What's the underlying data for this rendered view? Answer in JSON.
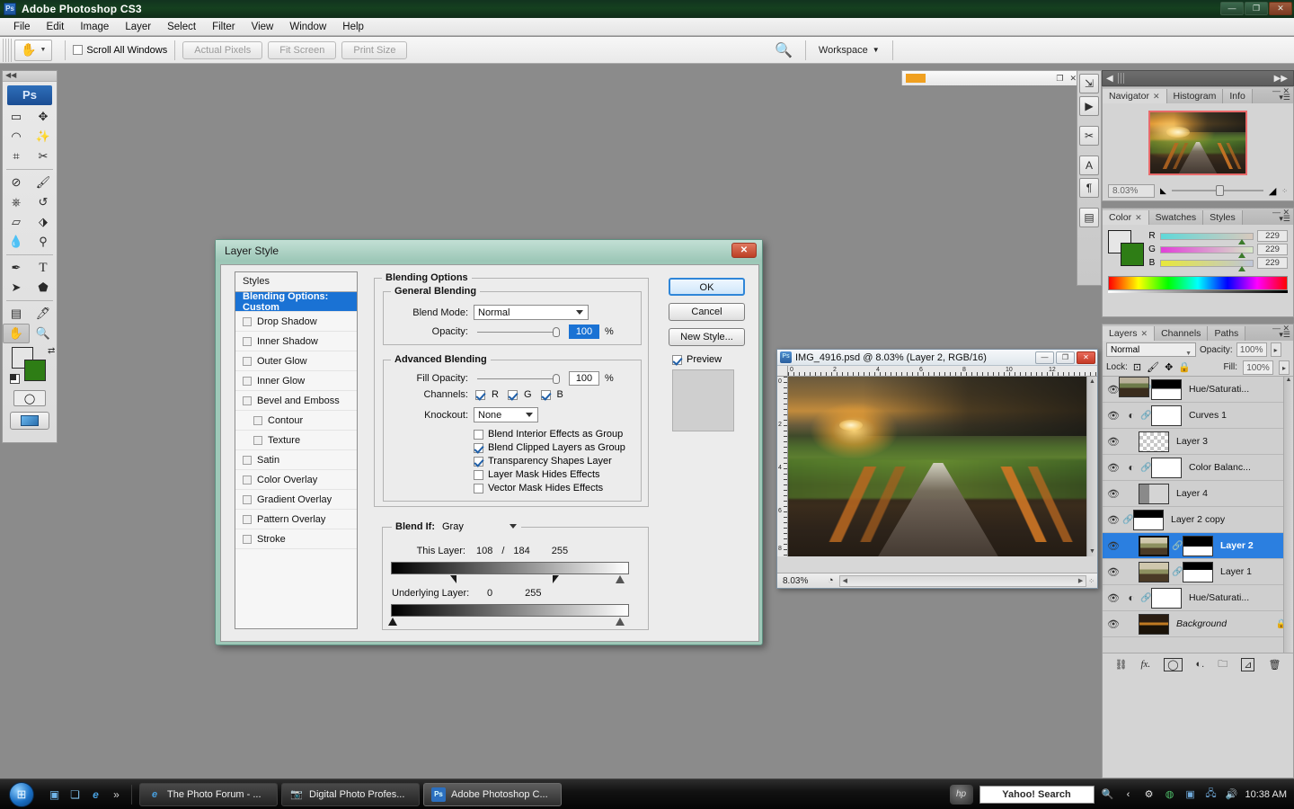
{
  "app": {
    "title": "Adobe Photoshop CS3",
    "logo_text": "Ps",
    "window_controls": {
      "minimize": "—",
      "restore": "❐",
      "close": "✕"
    }
  },
  "menubar": {
    "items": [
      "File",
      "Edit",
      "Image",
      "Layer",
      "Select",
      "Filter",
      "View",
      "Window",
      "Help"
    ]
  },
  "options_bar": {
    "tool_icon": "hand-tool-icon",
    "scroll_all_windows": {
      "label": "Scroll All Windows",
      "checked": false
    },
    "buttons": [
      "Actual Pixels",
      "Fit Screen",
      "Print Size"
    ],
    "bridge_icon": "go-to-bridge-icon",
    "workspace_label": "Workspace"
  },
  "toolbox": {
    "logo": "Ps",
    "tools": [
      "marquee-tool",
      "move-tool",
      "lasso-tool",
      "magic-wand-tool",
      "crop-tool",
      "slice-tool",
      "healing-brush-tool",
      "brush-tool",
      "clone-stamp-tool",
      "history-brush-tool",
      "eraser-tool",
      "paint-bucket-tool",
      "blur-tool",
      "dodge-tool",
      "pen-tool",
      "type-tool",
      "path-selection-tool",
      "shape-tool",
      "notes-tool",
      "eyedropper-tool",
      "hand-tool",
      "zoom-tool"
    ],
    "foreground_color": "#e6e6e6",
    "background_color": "#2e7d15",
    "quick_mask_label": "quick-mask-mode",
    "screen_mode_label": "screen-mode"
  },
  "mini_window": {
    "badge_text": "",
    "controls": [
      "❐",
      "✕"
    ]
  },
  "icon_dock": {
    "buttons": [
      "actions-icon",
      "animation-icon",
      "tool-presets-icon",
      "character-icon",
      "paragraph-icon",
      "layer-comps-icon"
    ]
  },
  "navigator_panel": {
    "tabs": [
      {
        "label": "Navigator",
        "active": true,
        "closable": true
      },
      {
        "label": "Histogram",
        "active": false,
        "closable": false
      },
      {
        "label": "Info",
        "active": false,
        "closable": false
      }
    ],
    "zoom_value": "8.03%",
    "zoom_out_icon": "zoom-out-icon",
    "zoom_in_icon": "zoom-in-icon"
  },
  "color_panel": {
    "tabs": [
      {
        "label": "Color",
        "active": true,
        "closable": true
      },
      {
        "label": "Swatches",
        "active": false,
        "closable": false
      },
      {
        "label": "Styles",
        "active": false,
        "closable": false
      }
    ],
    "channels": [
      {
        "label": "R",
        "value": "229"
      },
      {
        "label": "G",
        "value": "229"
      },
      {
        "label": "B",
        "value": "229"
      }
    ],
    "foreground_color": "#e6e6e6",
    "background_color": "#2e7d15"
  },
  "layers_panel": {
    "tabs": [
      {
        "label": "Layers",
        "active": true,
        "closable": true
      },
      {
        "label": "Channels",
        "active": false,
        "closable": false
      },
      {
        "label": "Paths",
        "active": false,
        "closable": false
      }
    ],
    "blend_mode": "Normal",
    "opacity_label": "Opacity:",
    "opacity_value": "100%",
    "lock_label": "Lock:",
    "lock_icons": [
      "lock-transparency-icon",
      "lock-image-icon",
      "lock-position-icon",
      "lock-all-icon"
    ],
    "fill_label": "Fill:",
    "fill_value": "100%",
    "layers": [
      {
        "name": "Hue/Saturati...",
        "selected": false,
        "adjustment": true,
        "linked": true,
        "mask": "maskA",
        "thumb": null
      },
      {
        "name": "Curves 1",
        "selected": false,
        "adjustment": true,
        "linked": true,
        "mask": "white",
        "thumb": null
      },
      {
        "name": "Layer 3",
        "selected": false,
        "adjustment": false,
        "linked": false,
        "mask": null,
        "thumb": "checker"
      },
      {
        "name": "Color Balanc...",
        "selected": false,
        "adjustment": true,
        "linked": true,
        "mask": "white",
        "thumb": null
      },
      {
        "name": "Layer 4",
        "selected": false,
        "adjustment": false,
        "linked": false,
        "mask": null,
        "thumb": "l4"
      },
      {
        "name": "Layer 2 copy",
        "selected": false,
        "adjustment": false,
        "linked": true,
        "mask": "maskB",
        "thumb": "photo"
      },
      {
        "name": "Layer 2",
        "selected": true,
        "adjustment": false,
        "linked": true,
        "mask": "maskC",
        "thumb": "photo2"
      },
      {
        "name": "Layer 1",
        "selected": false,
        "adjustment": false,
        "linked": true,
        "mask": "maskB",
        "thumb": "photo2"
      },
      {
        "name": "Hue/Saturati...",
        "selected": false,
        "adjustment": true,
        "linked": true,
        "mask": "white",
        "thumb": null
      },
      {
        "name": "Background",
        "selected": false,
        "adjustment": false,
        "linked": false,
        "mask": null,
        "thumb": "photo3",
        "italic": true,
        "locked": true
      }
    ],
    "footer_icons": [
      "link-layers-icon",
      "add-layer-style-icon",
      "add-layer-mask-icon",
      "new-adjustment-layer-icon",
      "new-group-icon",
      "new-layer-icon",
      "delete-layer-icon"
    ]
  },
  "document_window": {
    "title": "IMG_4916.psd @ 8.03% (Layer 2, RGB/16)",
    "icon": "photoshop-document-icon",
    "controls": {
      "minimize": "—",
      "maximize": "❐",
      "close": "✕"
    },
    "zoom": "8.03%",
    "ruler_h_ticks": [
      "0",
      "2",
      "4",
      "6",
      "8",
      "10",
      "12"
    ],
    "ruler_v_ticks": [
      "0",
      "2",
      "4",
      "6",
      "8"
    ]
  },
  "layer_style_dialog": {
    "title": "Layer Style",
    "close_label": "✕",
    "styles": {
      "header": "Styles",
      "items": [
        {
          "label": "Blending Options: Custom",
          "active": true,
          "checkbox": false,
          "sub": false
        },
        {
          "label": "Drop Shadow",
          "active": false,
          "checkbox": true,
          "checked": false,
          "sub": false
        },
        {
          "label": "Inner Shadow",
          "active": false,
          "checkbox": true,
          "checked": false,
          "sub": false
        },
        {
          "label": "Outer Glow",
          "active": false,
          "checkbox": true,
          "checked": false,
          "sub": false
        },
        {
          "label": "Inner Glow",
          "active": false,
          "checkbox": true,
          "checked": false,
          "sub": false
        },
        {
          "label": "Bevel and Emboss",
          "active": false,
          "checkbox": true,
          "checked": false,
          "sub": false
        },
        {
          "label": "Contour",
          "active": false,
          "checkbox": true,
          "checked": false,
          "sub": true
        },
        {
          "label": "Texture",
          "active": false,
          "checkbox": true,
          "checked": false,
          "sub": true
        },
        {
          "label": "Satin",
          "active": false,
          "checkbox": true,
          "checked": false,
          "sub": false
        },
        {
          "label": "Color Overlay",
          "active": false,
          "checkbox": true,
          "checked": false,
          "sub": false
        },
        {
          "label": "Gradient Overlay",
          "active": false,
          "checkbox": true,
          "checked": false,
          "sub": false
        },
        {
          "label": "Pattern Overlay",
          "active": false,
          "checkbox": true,
          "checked": false,
          "sub": false
        },
        {
          "label": "Stroke",
          "active": false,
          "checkbox": true,
          "checked": false,
          "sub": false
        }
      ]
    },
    "blending_options_label": "Blending Options",
    "general_blending": {
      "label": "General Blending",
      "blend_mode_label": "Blend Mode:",
      "blend_mode_value": "Normal",
      "opacity_label": "Opacity:",
      "opacity_value": "100",
      "opacity_unit": "%"
    },
    "advanced_blending": {
      "label": "Advanced Blending",
      "fill_opacity_label": "Fill Opacity:",
      "fill_opacity_value": "100",
      "fill_opacity_unit": "%",
      "channels_label": "Channels:",
      "channels": [
        {
          "label": "R",
          "checked": true
        },
        {
          "label": "G",
          "checked": true
        },
        {
          "label": "B",
          "checked": true
        }
      ],
      "knockout_label": "Knockout:",
      "knockout_value": "None",
      "checkboxes": [
        {
          "label": "Blend Interior Effects as Group",
          "checked": false
        },
        {
          "label": "Blend Clipped Layers as Group",
          "checked": true
        },
        {
          "label": "Transparency Shapes Layer",
          "checked": true
        },
        {
          "label": "Layer Mask Hides Effects",
          "checked": false
        },
        {
          "label": "Vector Mask Hides Effects",
          "checked": false
        }
      ]
    },
    "blend_if": {
      "label": "Blend If:",
      "channel_value": "Gray",
      "this_layer_label": "This Layer:",
      "this_layer_low": "108",
      "this_layer_sep": "/",
      "this_layer_low2": "184",
      "this_layer_high": "255",
      "underlying_label": "Underlying Layer:",
      "underlying_low": "0",
      "underlying_high": "255"
    },
    "buttons": {
      "ok": "OK",
      "cancel": "Cancel",
      "new_style": "New Style...",
      "preview_label": "Preview",
      "preview_checked": true
    }
  },
  "taskbar": {
    "start_icon": "windows-start-orb",
    "quick_launch": [
      "show-desktop-icon",
      "switch-windows-icon",
      "internet-explorer-icon"
    ],
    "quick_launch_more": "»",
    "tasks": [
      {
        "label": "The Photo Forum - ...",
        "icon": "internet-explorer-icon",
        "active": false
      },
      {
        "label": "Digital Photo Profes...",
        "icon": "camera-icon",
        "active": false
      },
      {
        "label": "Adobe Photoshop C...",
        "icon": "photoshop-icon",
        "active": true
      }
    ],
    "hp_logo": "hp",
    "search_box": "Yahoo! Search",
    "search_icon": "magnifier-icon",
    "tray_icons": [
      "chevron-left-icon",
      "loading-icon",
      "network-globe-icon",
      "security-icon",
      "network-icon",
      "volume-icon"
    ],
    "clock": "10:38 AM"
  }
}
